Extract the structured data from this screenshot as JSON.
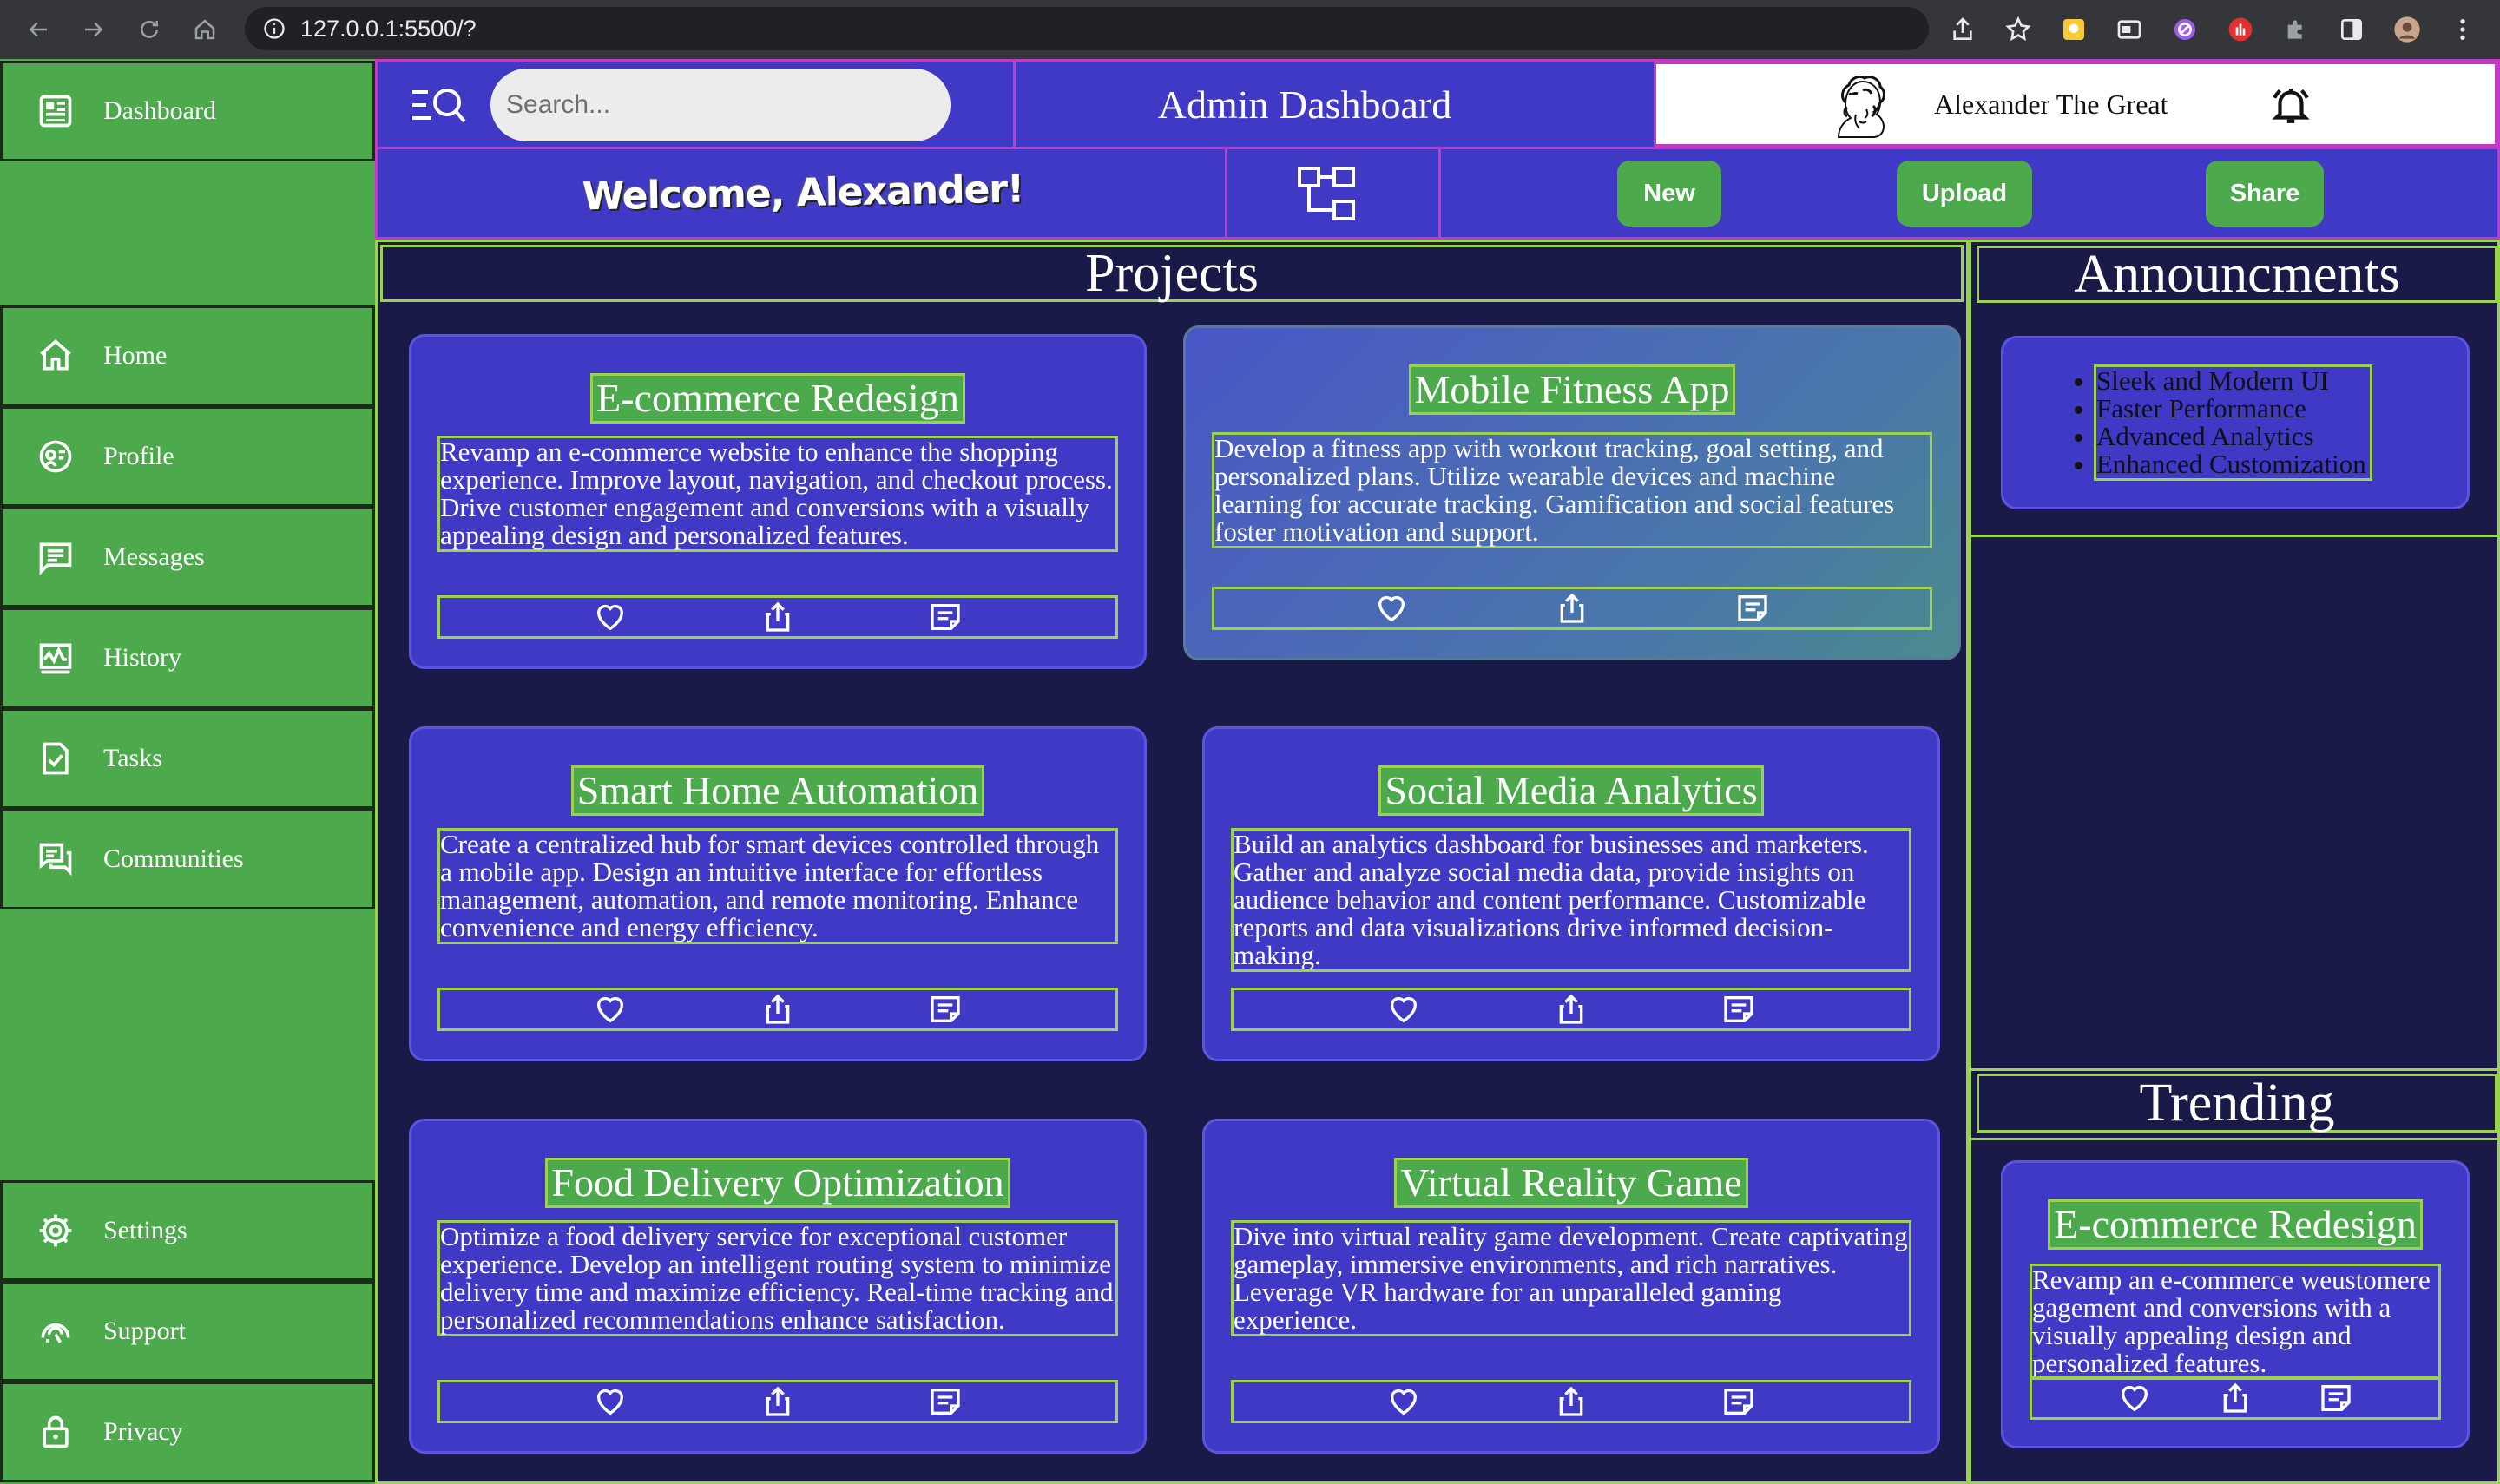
{
  "browser": {
    "url": "127.0.0.1:5500/?"
  },
  "sidebar": {
    "top": {
      "label": "Dashboard",
      "icon": "dashboard-icon"
    },
    "items": [
      {
        "label": "Home",
        "icon": "home-icon"
      },
      {
        "label": "Profile",
        "icon": "profile-icon"
      },
      {
        "label": "Messages",
        "icon": "messages-icon"
      },
      {
        "label": "History",
        "icon": "history-icon"
      },
      {
        "label": "Tasks",
        "icon": "tasks-icon"
      },
      {
        "label": "Communities",
        "icon": "communities-icon"
      }
    ],
    "bottom": [
      {
        "label": "Settings",
        "icon": "gear-icon"
      },
      {
        "label": "Support",
        "icon": "support-icon"
      },
      {
        "label": "Privacy",
        "icon": "lock-icon"
      }
    ]
  },
  "header": {
    "search_placeholder": "Search...",
    "title": "Admin Dashboard",
    "user_name": "Alexander The Great"
  },
  "subbar": {
    "welcome": "Welcome, Alexander!",
    "new_label": "New",
    "upload_label": "Upload",
    "share_label": "Share"
  },
  "projects": {
    "title": "Projects",
    "cards": [
      {
        "title": "E-commerce Redesign",
        "description": "Revamp an e-commerce website to enhance the shopping experience. Improve layout, navigation, and checkout process. Drive customer engagement and conversions with a visually appealing design and personalized features."
      },
      {
        "title": "Mobile Fitness App",
        "description": "Develop a fitness app with workout tracking, goal setting, and personalized plans. Utilize wearable devices and machine learning for accurate tracking. Gamification and social features foster motivation and support."
      },
      {
        "title": "Smart Home Automation",
        "description": "Create a centralized hub for smart devices controlled through a mobile app. Design an intuitive interface for effortless management, automation, and remote monitoring. Enhance convenience and energy efficiency."
      },
      {
        "title": "Social Media Analytics",
        "description": "Build an analytics dashboard for businesses and marketers. Gather and analyze social media data, provide insights on audience behavior and content performance. Customizable reports and data visualizations drive informed decision-making."
      },
      {
        "title": "Food Delivery Optimization",
        "description": "Optimize a food delivery service for exceptional customer experience. Develop an intelligent routing system to minimize delivery time and maximize efficiency. Real-time tracking and personalized recommendations enhance satisfaction."
      },
      {
        "title": "Virtual Reality Game",
        "description": "Dive into virtual reality game development. Create captivating gameplay, immersive environments, and rich narratives. Leverage VR hardware for an unparalleled gaming experience."
      }
    ]
  },
  "announcements": {
    "title": "Announcments",
    "items": [
      "Sleek and Modern UI",
      "Faster Performance",
      "Advanced Analytics",
      "Enhanced Customization"
    ]
  },
  "trending": {
    "title": "Trending",
    "card": {
      "title": "E-commerce Redesign",
      "description": "Revamp an e-commerce weustomere gagement and conversions with a visually appealing design and personalized features."
    }
  },
  "colors": {
    "sidebar_green": "#4caa4c",
    "header_blue": "#3f39c6",
    "panel_navy": "#191a47",
    "border_lime": "#9ad24f",
    "header_border_magenta": "#c23ac6"
  }
}
